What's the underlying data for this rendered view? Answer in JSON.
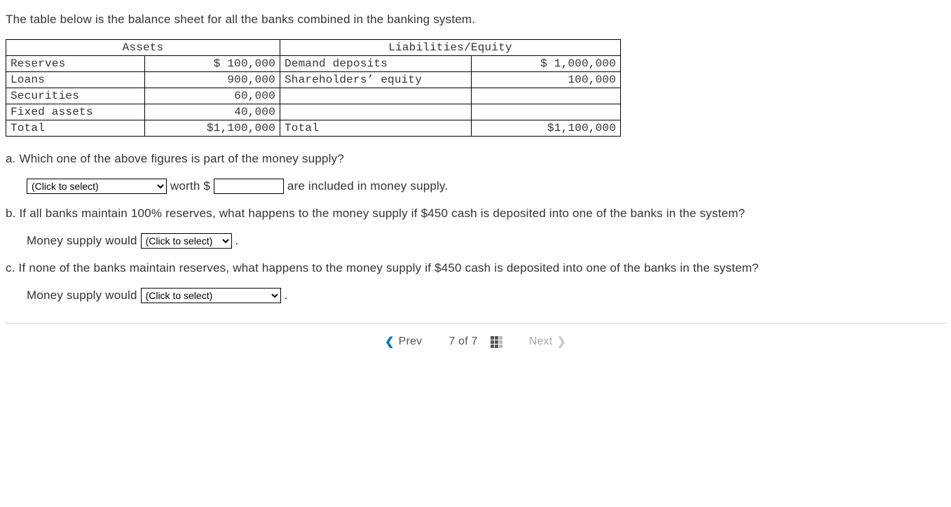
{
  "intro": "The table below is the balance sheet for all the banks combined in the banking system.",
  "table": {
    "assets_header": "Assets",
    "liab_header": "Liabilities/Equity",
    "rows": {
      "r1": {
        "a_label": "Reserves",
        "a_val": "$ 100,000",
        "l_label": "Demand deposits",
        "l_val": "$ 1,000,000"
      },
      "r2": {
        "a_label": "Loans",
        "a_val": "900,000",
        "l_label": "Shareholders’ equity",
        "l_val": "100,000"
      },
      "r3": {
        "a_label": "Securities",
        "a_val": "60,000",
        "l_label": "",
        "l_val": ""
      },
      "r4": {
        "a_label": "Fixed assets",
        "a_val": "40,000",
        "l_label": "",
        "l_val": ""
      },
      "r5": {
        "a_label": "Total",
        "a_val": "$1,100,000",
        "l_label": "Total",
        "l_val": "$1,100,000"
      }
    }
  },
  "qa": {
    "prompt": "a. Which one of the above figures is part of the money supply?",
    "select_placeholder": "(Click to select)",
    "mid1": " worth $ ",
    "tail": " are included in money supply."
  },
  "qb": {
    "prompt": "b. If all banks maintain 100% reserves, what happens to the money supply if $450 cash is deposited into one of the banks in the system?",
    "lead": "Money supply would ",
    "select_placeholder": "(Click to select)",
    "tail": " ."
  },
  "qc": {
    "prompt": "c. If none of the banks maintain reserves, what happens to the money supply if $450 cash is deposited into one of the banks in the system?",
    "lead": "Money supply would ",
    "select_placeholder": "(Click to select)",
    "tail": " ."
  },
  "nav": {
    "prev": "Prev",
    "next": "Next",
    "page_text": "7 of 7"
  }
}
